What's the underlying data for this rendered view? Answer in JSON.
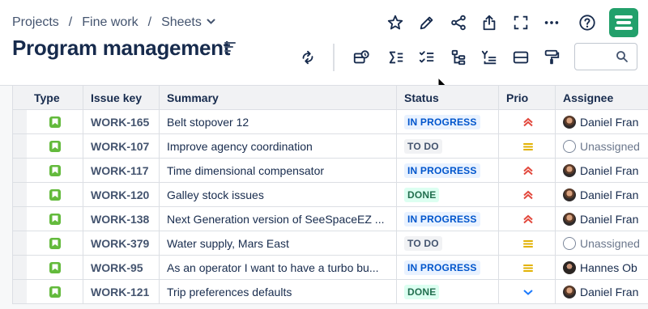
{
  "breadcrumb": {
    "items": [
      "Projects",
      "Fine work",
      "Sheets"
    ],
    "separator": "/"
  },
  "page": {
    "title": "Program management"
  },
  "search": {
    "placeholder": ""
  },
  "table": {
    "headers": {
      "type": "Type",
      "key": "Issue key",
      "summary": "Summary",
      "status": "Status",
      "prio": "Prio",
      "assignee": "Assignee"
    },
    "rows": [
      {
        "key": "WORK-165",
        "summary": "Belt stopover 12",
        "status": "IN PROGRESS",
        "prio": "high",
        "assignee": "Daniel Fran"
      },
      {
        "key": "WORK-107",
        "summary": "Improve agency coordination",
        "status": "TO DO",
        "prio": "medium",
        "assignee": "Unassigned"
      },
      {
        "key": "WORK-117",
        "summary": "Time dimensional compensator",
        "status": "IN PROGRESS",
        "prio": "high",
        "assignee": "Daniel Fran"
      },
      {
        "key": "WORK-120",
        "summary": "Galley stock issues",
        "status": "DONE",
        "prio": "high",
        "assignee": "Daniel Fran"
      },
      {
        "key": "WORK-138",
        "summary": "Next Generation version of SeeSpaceEZ ...",
        "status": "IN PROGRESS",
        "prio": "high",
        "assignee": "Daniel Fran"
      },
      {
        "key": "WORK-379",
        "summary": "Water supply, Mars East",
        "status": "TO DO",
        "prio": "medium",
        "assignee": "Unassigned"
      },
      {
        "key": "WORK-95",
        "summary": "As an operator I want to have a turbo bu...",
        "status": "IN PROGRESS",
        "prio": "medium",
        "assignee": "Hannes Ob"
      },
      {
        "key": "WORK-121",
        "summary": "Trip preferences defaults",
        "status": "DONE",
        "prio": "low",
        "assignee": "Daniel Fran"
      }
    ]
  },
  "colors": {
    "brand": "#22a06b",
    "in_progress_bg": "#e9f2ff",
    "in_progress_fg": "#0055cc",
    "todo_bg": "#f1f2f4",
    "todo_fg": "#44546f",
    "done_bg": "#dcfff1",
    "done_fg": "#216e4e",
    "prio_high": "#e2483d",
    "prio_medium": "#e2b203",
    "prio_low": "#1d7afc"
  },
  "icons": {
    "toolbar": [
      "sync-icon",
      "add-field-icon",
      "sum-icon",
      "checklist-icon",
      "hierarchy-icon",
      "filter-list-icon",
      "row-height-icon",
      "format-painter-icon"
    ],
    "header": [
      "star-icon",
      "pencil-icon",
      "share-icon",
      "export-icon",
      "fullscreen-icon",
      "more-icon",
      "help-icon"
    ]
  }
}
